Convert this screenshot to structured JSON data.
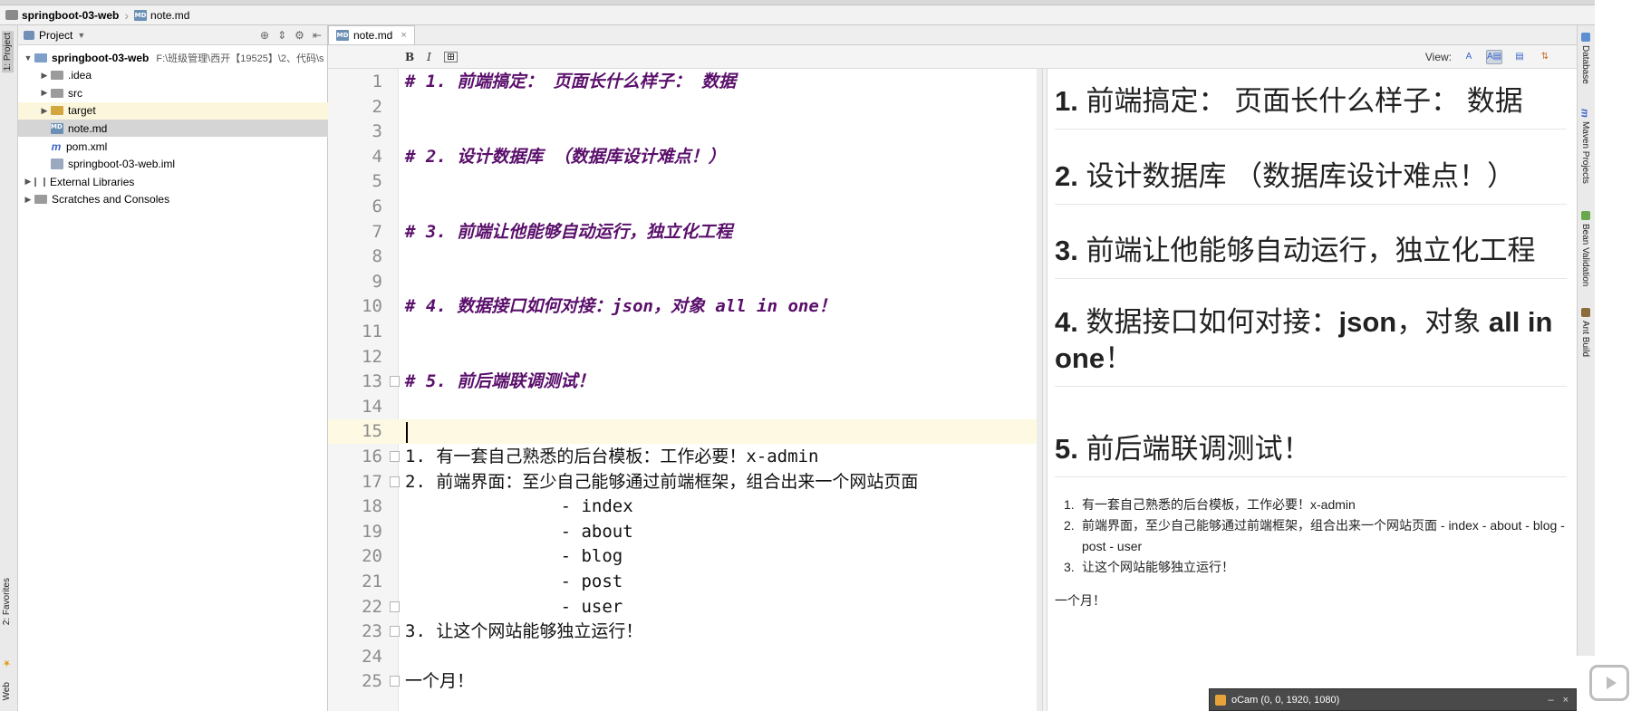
{
  "navbar": {
    "project_crumb": "springboot-03-web",
    "file_crumb": "note.md"
  },
  "left_strip": {
    "project_tab": "1: Project",
    "favorites_tab": "2: Favorites",
    "web_tab": "Web"
  },
  "right_strip": {
    "tabs": [
      "Database",
      "Maven Projects",
      "Bean Validation",
      "Ant Build"
    ]
  },
  "project_panel": {
    "title": "Project",
    "tree": [
      {
        "label": "springboot-03-web",
        "path": "F:\\班级管理\\西开【19525】\\2、代码\\s",
        "kind": "module"
      },
      {
        "label": ".idea",
        "kind": "folder"
      },
      {
        "label": "src",
        "kind": "folder"
      },
      {
        "label": "target",
        "kind": "folder"
      },
      {
        "label": "note.md",
        "kind": "md"
      },
      {
        "label": "pom.xml",
        "kind": "maven"
      },
      {
        "label": "springboot-03-web.iml",
        "kind": "iml"
      },
      {
        "label": "External Libraries",
        "kind": "lib"
      },
      {
        "label": "Scratches and Consoles",
        "kind": "scratch"
      }
    ]
  },
  "editor_tab": {
    "label": "note.md"
  },
  "md_toolbar": {
    "bold": "B",
    "italic": "I",
    "view_label": "View:"
  },
  "editor": {
    "lines": [
      {
        "n": "1",
        "text": "# 1. 前端搞定： 页面长什么样子： 数据",
        "heading": true
      },
      {
        "n": "2",
        "text": ""
      },
      {
        "n": "3",
        "text": ""
      },
      {
        "n": "4",
        "text": "# 2. 设计数据库 （数据库设计难点！）",
        "heading": true
      },
      {
        "n": "5",
        "text": ""
      },
      {
        "n": "6",
        "text": ""
      },
      {
        "n": "7",
        "text": "# 3. 前端让他能够自动运行，独立化工程",
        "heading": true
      },
      {
        "n": "8",
        "text": ""
      },
      {
        "n": "9",
        "text": ""
      },
      {
        "n": "10",
        "text": "# 4. 数据接口如何对接：json，对象 all in one！",
        "heading": true
      },
      {
        "n": "11",
        "text": ""
      },
      {
        "n": "12",
        "text": ""
      },
      {
        "n": "13",
        "text": "# 5. 前后端联调测试！",
        "heading": true
      },
      {
        "n": "14",
        "text": ""
      },
      {
        "n": "15",
        "text": ""
      },
      {
        "n": "16",
        "text": "1. 有一套自己熟悉的后台模板：工作必要！x-admin"
      },
      {
        "n": "17",
        "text": "2. 前端界面：至少自己能够通过前端框架，组合出来一个网站页面"
      },
      {
        "n": "18",
        "text": "               - index"
      },
      {
        "n": "19",
        "text": "               - about"
      },
      {
        "n": "20",
        "text": "               - blog"
      },
      {
        "n": "21",
        "text": "               - post"
      },
      {
        "n": "22",
        "text": "               - user"
      },
      {
        "n": "23",
        "text": "3. 让这个网站能够独立运行！"
      },
      {
        "n": "24",
        "text": ""
      },
      {
        "n": "25",
        "text": "一个月！"
      }
    ]
  },
  "preview": {
    "headings": [
      {
        "num": "1.",
        "text": "前端搞定： 页面长什么样子： 数据"
      },
      {
        "num": "2.",
        "text": "设计数据库 （数据库设计难点！）"
      },
      {
        "num": "3.",
        "text": "前端让他能够自动运行，独立化工程"
      },
      {
        "num": "4.",
        "text_a": "数据接口如何对接：",
        "bold_a": "json",
        "text_b": "，对象 ",
        "bold_b": "all in one",
        "text_c": "！"
      },
      {
        "num": "5.",
        "text": "前后端联调测试！"
      }
    ],
    "list": [
      {
        "n": "1.",
        "text": "有一套自己熟悉的后台模板，工作必要！x-admin"
      },
      {
        "n": "2.",
        "text": "前端界面，至少自己能够通过前端框架，组合出来一个网站页面 - index - about - blog - post - user"
      },
      {
        "n": "3.",
        "text": "让这个网站能够独立运行！"
      }
    ],
    "tail": "一个月！"
  },
  "ocam": {
    "title": "oCam (0, 0, 1920, 1080)"
  },
  "colors": {
    "heading_purple": "#5a0f6b",
    "current_line": "#fdf9e3",
    "selected_row": "#d5d5d5",
    "target_row": "#fcf7dc"
  }
}
